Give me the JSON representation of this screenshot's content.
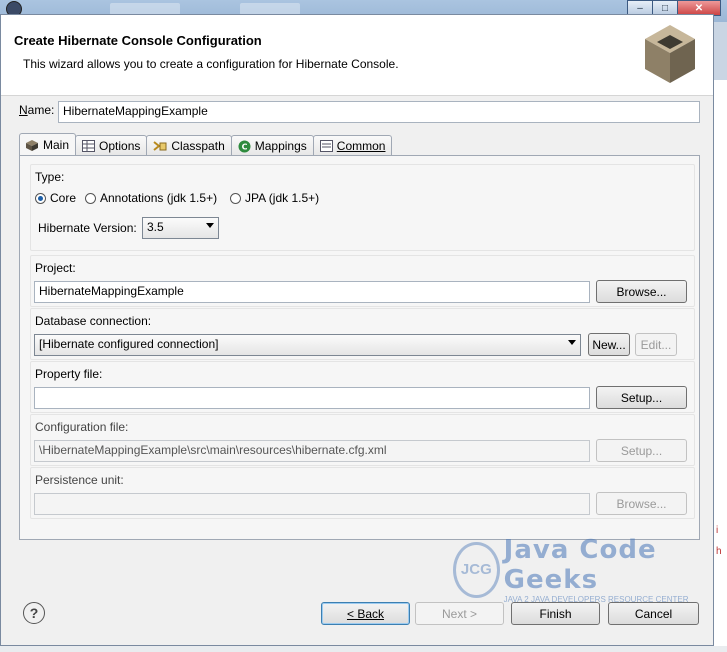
{
  "window": {
    "close_glyph": "✕",
    "min_glyph": "–",
    "max_glyph": "□"
  },
  "header": {
    "title": "Create Hibernate Console Configuration",
    "description": "This wizard allows you to create a configuration for Hibernate Console."
  },
  "name": {
    "label_prefix": "N",
    "label_rest": "ame:",
    "value": "HibernateMappingExample"
  },
  "tabs": [
    {
      "label": "Main",
      "icon": "hibernate-icon"
    },
    {
      "label": "Options",
      "icon": "table-icon"
    },
    {
      "label": "Classpath",
      "icon": "classpath-icon"
    },
    {
      "label": "Mappings",
      "icon": "mappings-icon"
    },
    {
      "label": "Common",
      "icon": "common-icon"
    }
  ],
  "type": {
    "label": "Type:",
    "options": [
      "Core",
      "Annotations (jdk 1.5+)",
      "JPA (jdk 1.5+)"
    ],
    "selected": "Core",
    "version_label": "Hibernate Version:",
    "version_value": "3.5"
  },
  "project": {
    "label": "Project:",
    "value": "HibernateMappingExample",
    "browse": "Browse..."
  },
  "database": {
    "label": "Database connection:",
    "value": "[Hibernate configured connection]",
    "new": "New...",
    "edit": "Edit..."
  },
  "property": {
    "label": "Property file:",
    "value": "",
    "setup": "Setup..."
  },
  "configuration": {
    "label": "Configuration file:",
    "value": "\\HibernateMappingExample\\src\\main\\resources\\hibernate.cfg.xml",
    "setup": "Setup..."
  },
  "persistence": {
    "label": "Persistence unit:",
    "value": "",
    "browse": "Browse..."
  },
  "footer": {
    "help": "?",
    "back": "< Back",
    "next": "Next >",
    "finish": "Finish",
    "cancel": "Cancel"
  },
  "watermark": {
    "logo": "JCG",
    "title": "Java Code Geeks",
    "subtitle": "JAVA 2 JAVA DEVELOPERS RESOURCE CENTER"
  },
  "colors": {
    "accent": "#3c7fb1",
    "dialog_bg": "#f0f0f0"
  }
}
